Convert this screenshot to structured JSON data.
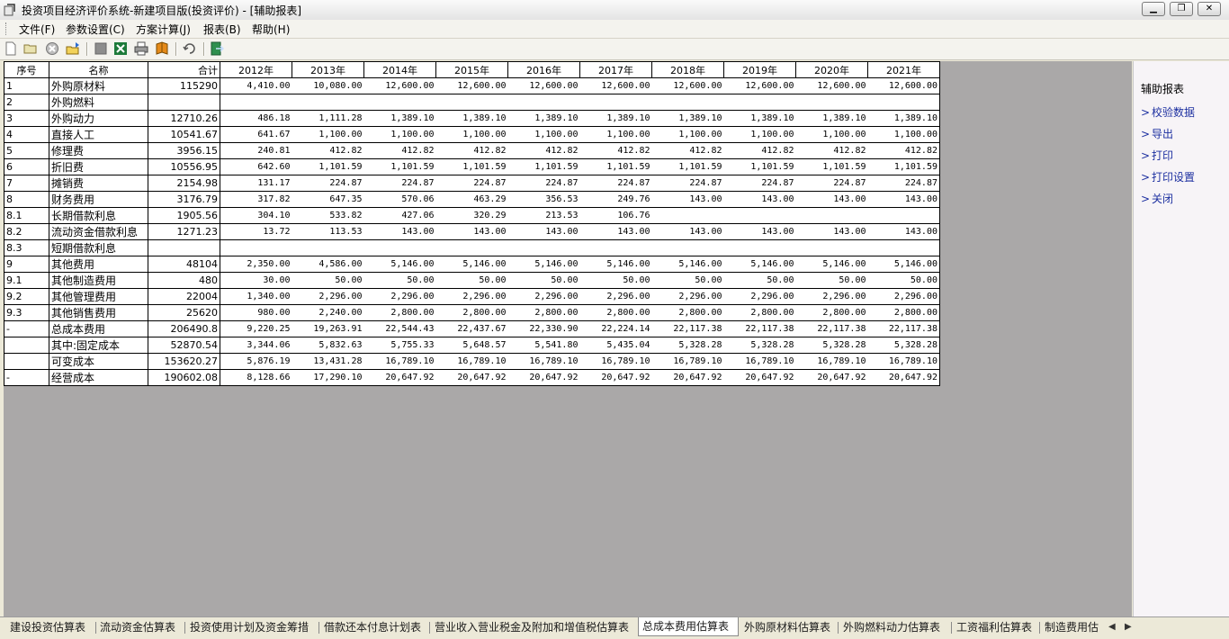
{
  "window": {
    "title": "投资项目经济评价系统-新建项目版(投资评价) - [辅助报表]",
    "minimize_glyph": "▁",
    "restore_glyph": "❐",
    "close_glyph": "✕"
  },
  "menu": [
    "文件(F)",
    "参数设置(C)",
    "方案计算(J)",
    "报表(B)",
    "帮助(H)"
  ],
  "toolbar_icons": [
    "new-file-icon",
    "open-folder-icon",
    "delete-icon",
    "export-folder-icon",
    "stop-icon",
    "excel-icon",
    "print-icon",
    "book-icon",
    "refresh-icon",
    "exit-icon"
  ],
  "table": {
    "headers": {
      "no": "序号",
      "name": "名称",
      "total": "合计",
      "years": [
        "2012年",
        "2013年",
        "2014年",
        "2015年",
        "2016年",
        "2017年",
        "2018年",
        "2019年",
        "2020年",
        "2021年"
      ]
    },
    "rows": [
      {
        "no": "1",
        "name": "外购原材料",
        "total": "115290",
        "values": [
          "4,410.00",
          "10,080.00",
          "12,600.00",
          "12,600.00",
          "12,600.00",
          "12,600.00",
          "12,600.00",
          "12,600.00",
          "12,600.00",
          "12,600.00"
        ]
      },
      {
        "no": "2",
        "name": "外购燃料",
        "total": "",
        "values": [
          "",
          "",
          "",
          "",
          "",
          "",
          "",
          "",
          "",
          ""
        ]
      },
      {
        "no": "3",
        "name": "外购动力",
        "total": "12710.26",
        "values": [
          "486.18",
          "1,111.28",
          "1,389.10",
          "1,389.10",
          "1,389.10",
          "1,389.10",
          "1,389.10",
          "1,389.10",
          "1,389.10",
          "1,389.10"
        ]
      },
      {
        "no": "4",
        "name": "直接人工",
        "total": "10541.67",
        "values": [
          "641.67",
          "1,100.00",
          "1,100.00",
          "1,100.00",
          "1,100.00",
          "1,100.00",
          "1,100.00",
          "1,100.00",
          "1,100.00",
          "1,100.00"
        ]
      },
      {
        "no": "5",
        "name": "修理费",
        "total": "3956.15",
        "values": [
          "240.81",
          "412.82",
          "412.82",
          "412.82",
          "412.82",
          "412.82",
          "412.82",
          "412.82",
          "412.82",
          "412.82"
        ]
      },
      {
        "no": "6",
        "name": "折旧费",
        "total": "10556.95",
        "values": [
          "642.60",
          "1,101.59",
          "1,101.59",
          "1,101.59",
          "1,101.59",
          "1,101.59",
          "1,101.59",
          "1,101.59",
          "1,101.59",
          "1,101.59"
        ]
      },
      {
        "no": "7",
        "name": "摊销费",
        "total": "2154.98",
        "values": [
          "131.17",
          "224.87",
          "224.87",
          "224.87",
          "224.87",
          "224.87",
          "224.87",
          "224.87",
          "224.87",
          "224.87"
        ]
      },
      {
        "no": "8",
        "name": "财务费用",
        "total": "3176.79",
        "values": [
          "317.82",
          "647.35",
          "570.06",
          "463.29",
          "356.53",
          "249.76",
          "143.00",
          "143.00",
          "143.00",
          "143.00"
        ]
      },
      {
        "no": "8.1",
        "name": "长期借款利息",
        "total": "1905.56",
        "values": [
          "304.10",
          "533.82",
          "427.06",
          "320.29",
          "213.53",
          "106.76",
          "",
          "",
          "",
          ""
        ]
      },
      {
        "no": "8.2",
        "name": "流动资金借款利息",
        "total": "1271.23",
        "values": [
          "13.72",
          "113.53",
          "143.00",
          "143.00",
          "143.00",
          "143.00",
          "143.00",
          "143.00",
          "143.00",
          "143.00"
        ]
      },
      {
        "no": "8.3",
        "name": "短期借款利息",
        "total": "",
        "values": [
          "",
          "",
          "",
          "",
          "",
          "",
          "",
          "",
          "",
          ""
        ]
      },
      {
        "no": "9",
        "name": "其他费用",
        "total": "48104",
        "values": [
          "2,350.00",
          "4,586.00",
          "5,146.00",
          "5,146.00",
          "5,146.00",
          "5,146.00",
          "5,146.00",
          "5,146.00",
          "5,146.00",
          "5,146.00"
        ]
      },
      {
        "no": "9.1",
        "name": "其他制造费用",
        "total": "480",
        "values": [
          "30.00",
          "50.00",
          "50.00",
          "50.00",
          "50.00",
          "50.00",
          "50.00",
          "50.00",
          "50.00",
          "50.00"
        ]
      },
      {
        "no": "9.2",
        "name": "其他管理费用",
        "total": "22004",
        "values": [
          "1,340.00",
          "2,296.00",
          "2,296.00",
          "2,296.00",
          "2,296.00",
          "2,296.00",
          "2,296.00",
          "2,296.00",
          "2,296.00",
          "2,296.00"
        ]
      },
      {
        "no": "9.3",
        "name": "其他销售费用",
        "total": "25620",
        "values": [
          "980.00",
          "2,240.00",
          "2,800.00",
          "2,800.00",
          "2,800.00",
          "2,800.00",
          "2,800.00",
          "2,800.00",
          "2,800.00",
          "2,800.00"
        ]
      },
      {
        "no": "-",
        "name": "总成本费用",
        "total": "206490.8",
        "values": [
          "9,220.25",
          "19,263.91",
          "22,544.43",
          "22,437.67",
          "22,330.90",
          "22,224.14",
          "22,117.38",
          "22,117.38",
          "22,117.38",
          "22,117.38"
        ]
      },
      {
        "no": "",
        "name": "其中:固定成本",
        "total": "52870.54",
        "values": [
          "3,344.06",
          "5,832.63",
          "5,755.33",
          "5,648.57",
          "5,541.80",
          "5,435.04",
          "5,328.28",
          "5,328.28",
          "5,328.28",
          "5,328.28"
        ]
      },
      {
        "no": "",
        "name": "可变成本",
        "total": "153620.27",
        "values": [
          "5,876.19",
          "13,431.28",
          "16,789.10",
          "16,789.10",
          "16,789.10",
          "16,789.10",
          "16,789.10",
          "16,789.10",
          "16,789.10",
          "16,789.10"
        ]
      },
      {
        "no": "-",
        "name": "经营成本",
        "total": "190602.08",
        "values": [
          "8,128.66",
          "17,290.10",
          "20,647.92",
          "20,647.92",
          "20,647.92",
          "20,647.92",
          "20,647.92",
          "20,647.92",
          "20,647.92",
          "20,647.92"
        ]
      }
    ]
  },
  "panel": {
    "title": "辅助报表",
    "chevron": ">",
    "links": [
      "校验数据",
      "导出",
      "打印",
      "打印设置",
      "关闭"
    ]
  },
  "tabs": {
    "items": [
      "建设投资估算表",
      "流动资金估算表",
      "投资使用计划及资金筹措",
      "借款还本付息计划表",
      "营业收入营业税金及附加和增值税估算表",
      "总成本费用估算表",
      "外购原材料估算表",
      "外购燃料动力估算表",
      "工资福利估算表",
      "制造费用估"
    ],
    "active_index": 5,
    "left_arrow": "◀",
    "right_arrow": "▶"
  }
}
